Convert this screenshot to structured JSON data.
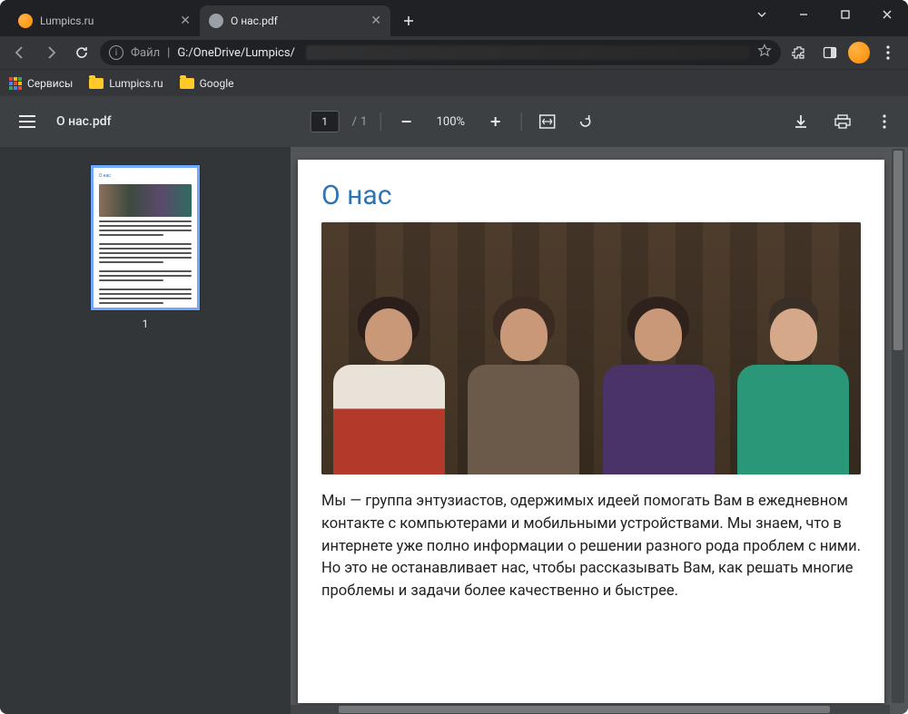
{
  "tabs": [
    {
      "title": "Lumpics.ru",
      "active": false
    },
    {
      "title": "О нас.pdf",
      "active": true
    }
  ],
  "address": {
    "file_label": "Файл",
    "path_visible": "G:/OneDrive/Lumpics/"
  },
  "bookmarks": {
    "apps": "Сервисы",
    "items": [
      "Lumpics.ru",
      "Google"
    ]
  },
  "pdf_toolbar": {
    "filename": "О нас.pdf",
    "page_current": "1",
    "page_sep": "/",
    "page_total": "1",
    "zoom": "100%"
  },
  "thumbnail": {
    "page_number": "1"
  },
  "document": {
    "heading": "О нас",
    "paragraph": "Мы — группа энтузиастов, одержимых идеей помогать Вам в ежедневном контакте с компьютерами и мобильными устройствами. Мы знаем, что в интернете уже полно информации о решении разного рода проблем с ними. Но это не останавливает нас, чтобы рассказывать Вам, как решать многие проблемы и задачи более качественно и быстрее."
  }
}
